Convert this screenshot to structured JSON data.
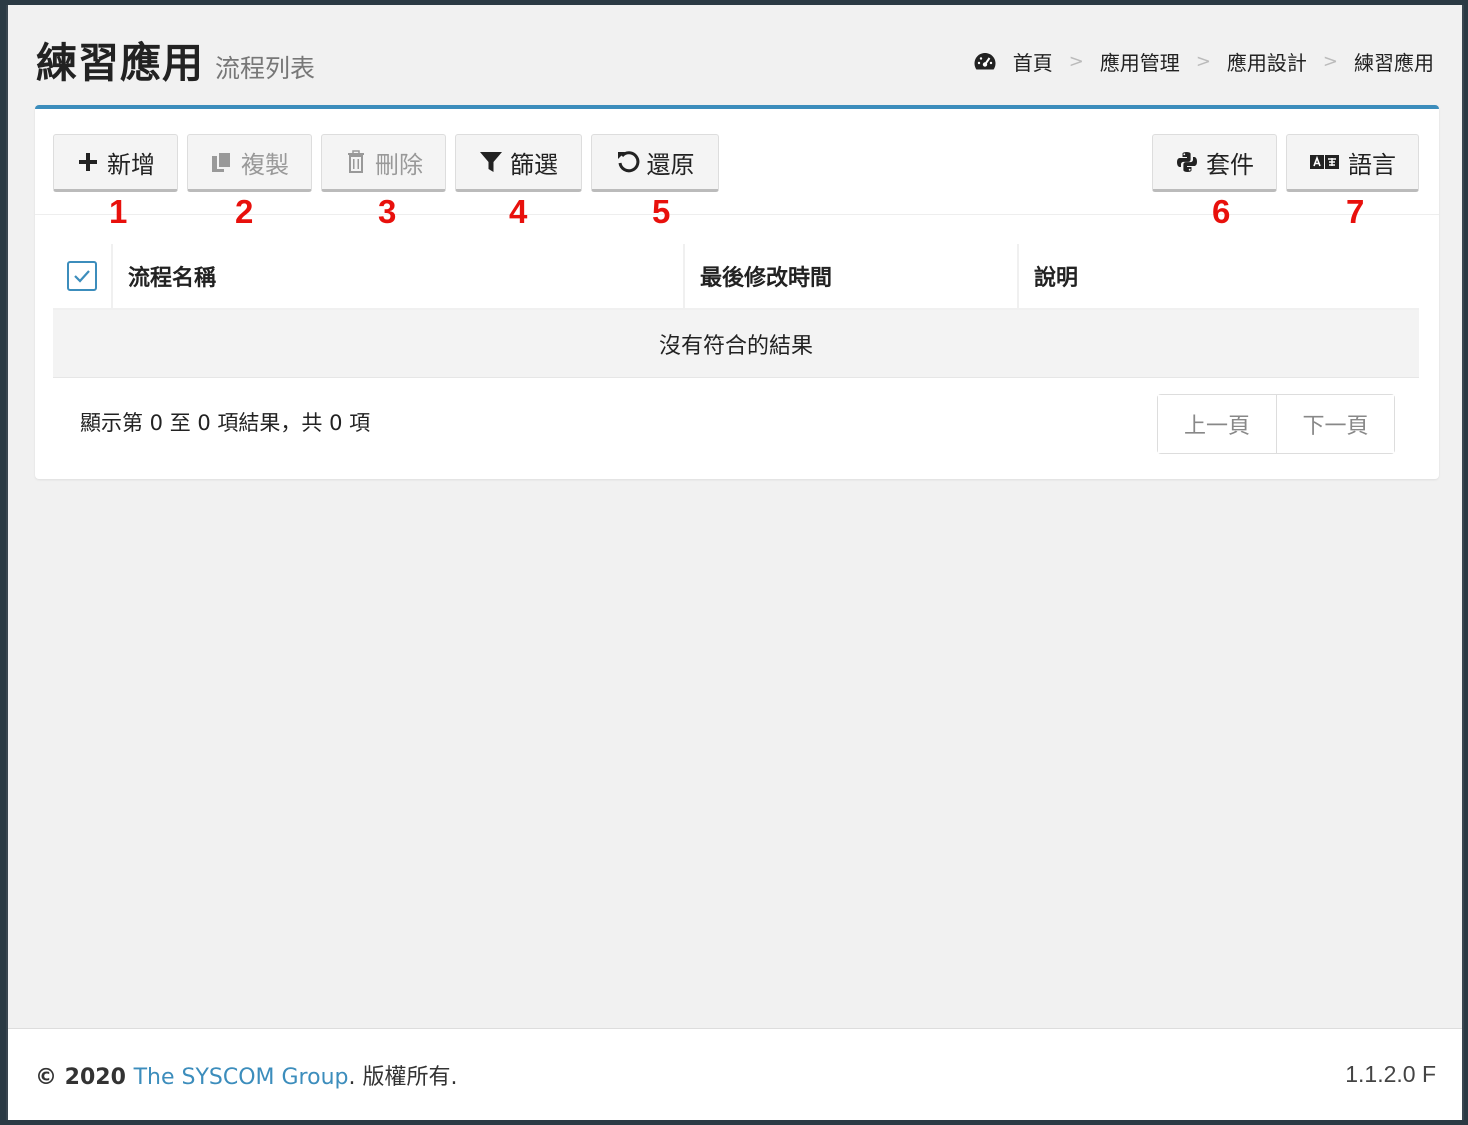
{
  "header": {
    "title": "練習應用",
    "subtitle": "流程列表"
  },
  "breadcrumb": {
    "home_icon": "dashboard-icon",
    "items": [
      "首頁",
      "應用管理",
      "應用設計",
      "練習應用"
    ],
    "separator": ">"
  },
  "toolbar": {
    "add": {
      "label": "新增",
      "icon": "plus-icon",
      "marker": "1"
    },
    "copy": {
      "label": "複製",
      "icon": "copy-icon",
      "marker": "2"
    },
    "delete": {
      "label": "刪除",
      "icon": "trash-icon",
      "marker": "3"
    },
    "filter": {
      "label": "篩選",
      "icon": "filter-icon",
      "marker": "4"
    },
    "restore": {
      "label": "還原",
      "icon": "undo-icon",
      "marker": "5"
    },
    "package": {
      "label": "套件",
      "icon": "python-icon",
      "marker": "6"
    },
    "language": {
      "label": "語言",
      "icon": "language-icon",
      "marker": "7"
    }
  },
  "table": {
    "columns": [
      "流程名稱",
      "最後修改時間",
      "說明"
    ],
    "empty_text": "沒有符合的結果"
  },
  "pagination": {
    "info": "顯示第 0 至 0 項結果，共 0 項",
    "prev": "上一頁",
    "next": "下一頁"
  },
  "footer": {
    "copyright_prefix": "© 2020 ",
    "company": "The SYSCOM Group",
    "suffix": ". 版權所有.",
    "version": "1.1.2.0 F"
  },
  "colors": {
    "accent": "#3c8dbc",
    "marker": "#e8100c"
  }
}
